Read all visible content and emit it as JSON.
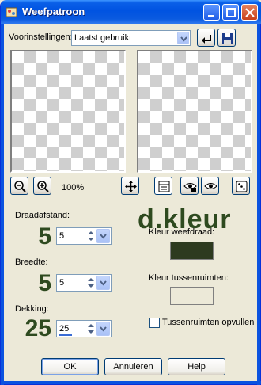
{
  "window": {
    "title": "Weefpatroon"
  },
  "presets": {
    "label": "Voorinstellingen:",
    "value": "Laatst gebruikt"
  },
  "zoom": {
    "value": "100%"
  },
  "overlay_text": "d.kleur",
  "fields": {
    "draadafstand": {
      "label": "Draadafstand:",
      "big_value": "5",
      "value": "5"
    },
    "breedte": {
      "label": "Breedte:",
      "big_value": "5",
      "value": "5"
    },
    "dekking": {
      "label": "Dekking:",
      "big_value": "25",
      "value": "25",
      "level": 0.25
    }
  },
  "colors": {
    "weave_label": "Kleur weefdraad:",
    "weave_color": "#2d3a1f",
    "gap_label": "Kleur tussenruimten:",
    "gap_color": "#ece9d8",
    "big_text_color": "#2e4a1f"
  },
  "fill_gaps": {
    "label": "Tussenruimten opvullen",
    "checked": false
  },
  "buttons": {
    "ok": "OK",
    "cancel": "Annuleren",
    "help": "Help"
  }
}
